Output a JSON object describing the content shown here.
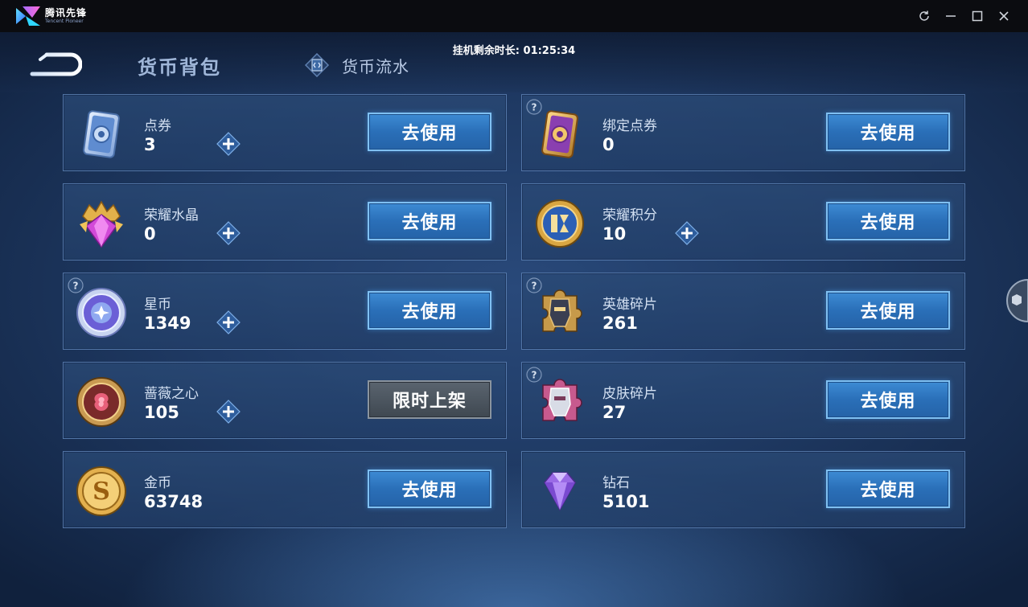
{
  "app": {
    "title_cn": "腾讯先锋",
    "title_en": "Tencent Pioneer"
  },
  "header": {
    "timer_text": "挂机剩余时长: 01:25:34",
    "tab_backpack": "货币背包",
    "tab_flow": "货币流水"
  },
  "buttons": {
    "use": "去使用",
    "limited": "限时上架"
  },
  "items": [
    {
      "name": "点券",
      "value": "3",
      "has_plus": true,
      "has_help": false,
      "action": "use",
      "icon": "coupon-icon"
    },
    {
      "name": "绑定点券",
      "value": "0",
      "has_plus": false,
      "has_help": true,
      "action": "use",
      "icon": "bound-coupon-icon"
    },
    {
      "name": "荣耀水晶",
      "value": "0",
      "has_plus": true,
      "has_help": false,
      "action": "use",
      "icon": "glory-crystal-icon"
    },
    {
      "name": "荣耀积分",
      "value": "10",
      "has_plus": true,
      "has_help": false,
      "action": "use",
      "icon": "glory-points-icon"
    },
    {
      "name": "星币",
      "value": "1349",
      "has_plus": true,
      "has_help": true,
      "action": "use",
      "icon": "star-coin-icon"
    },
    {
      "name": "英雄碎片",
      "value": "261",
      "has_plus": false,
      "has_help": true,
      "action": "use",
      "icon": "hero-fragment-icon"
    },
    {
      "name": "蔷薇之心",
      "value": "105",
      "has_plus": true,
      "has_help": false,
      "action": "limited",
      "icon": "rose-heart-icon"
    },
    {
      "name": "皮肤碎片",
      "value": "27",
      "has_plus": false,
      "has_help": true,
      "action": "use",
      "icon": "skin-fragment-icon"
    },
    {
      "name": "金币",
      "value": "63748",
      "has_plus": false,
      "has_help": false,
      "action": "use",
      "icon": "gold-coin-icon"
    },
    {
      "name": "钻石",
      "value": "5101",
      "has_plus": false,
      "has_help": false,
      "action": "use",
      "icon": "diamond-icon"
    }
  ],
  "colors": {
    "button_blue": "#2a6fb8",
    "button_border": "#7fc0f2",
    "card_border": "#789fd7",
    "limited_gray": "#4d5660"
  }
}
